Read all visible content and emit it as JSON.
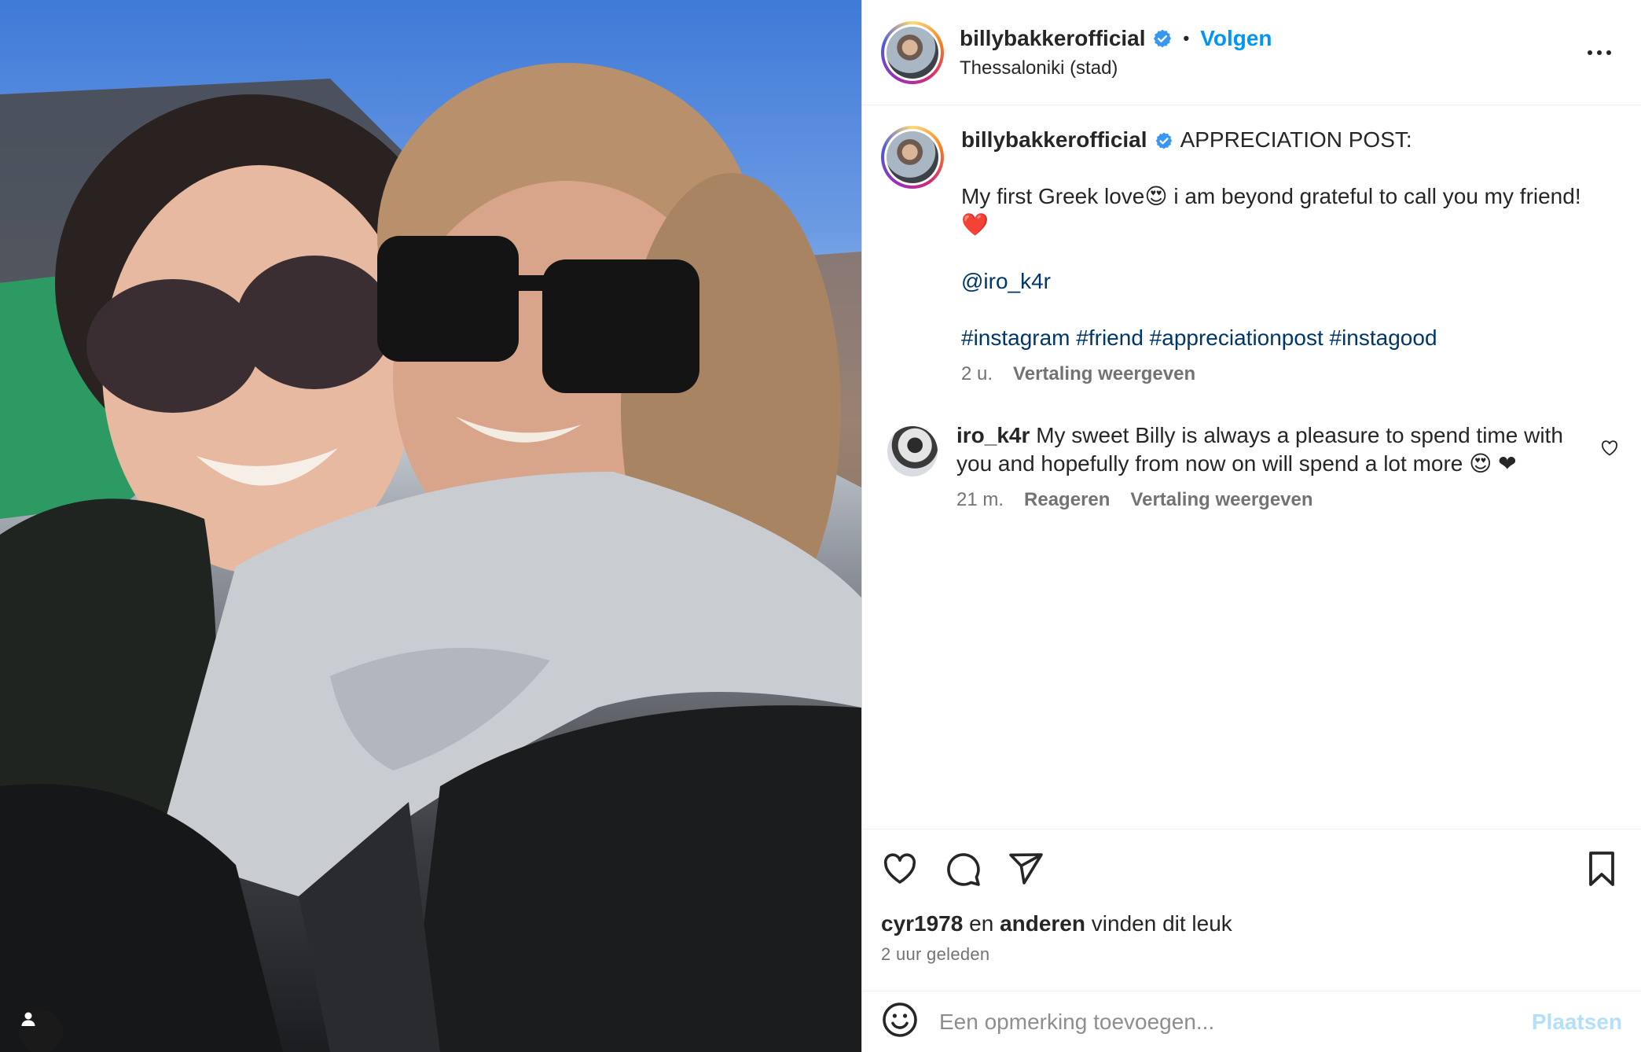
{
  "post": {
    "author": "billybakkerofficial",
    "follow_label": "Volgen",
    "dot": "•",
    "location": "Thessaloniki (stad)"
  },
  "caption": {
    "username": "billybakkerofficial",
    "line1": "APPRECIATION POST:",
    "line2": "My first Greek love😍 i am beyond grateful to call you my friend! ❤️",
    "mention": "@iro_k4r",
    "hashtags": "#instagram #friend #appreciationpost #instagood",
    "time": "2 u.",
    "translate": "Vertaling weergeven"
  },
  "comment": {
    "username": "iro_k4r",
    "text": "My sweet Billy is always a pleasure to spend time with you and hopefully from now on will spend a lot more 😍 ❤",
    "time": "21 m.",
    "reply": "Reageren",
    "translate": "Vertaling weergeven"
  },
  "likes": {
    "user": "cyr1978",
    "and": "en",
    "others": "anderen",
    "suffix": "vinden dit leuk"
  },
  "timestamp": "2 uur geleden",
  "add_comment": {
    "placeholder": "Een opmerking toevoegen...",
    "post_label": "Plaatsen"
  },
  "colors": {
    "link_blue": "#0095f6",
    "hashtag": "#00376b",
    "verified": "#3897f0",
    "secondary_text": "#737373",
    "post_disabled": "#b2dffc"
  },
  "icons": [
    "user-tag-icon",
    "verified-badge-icon",
    "more-options-icon",
    "heart-icon",
    "comment-icon",
    "share-icon",
    "save-icon",
    "emoji-icon"
  ]
}
